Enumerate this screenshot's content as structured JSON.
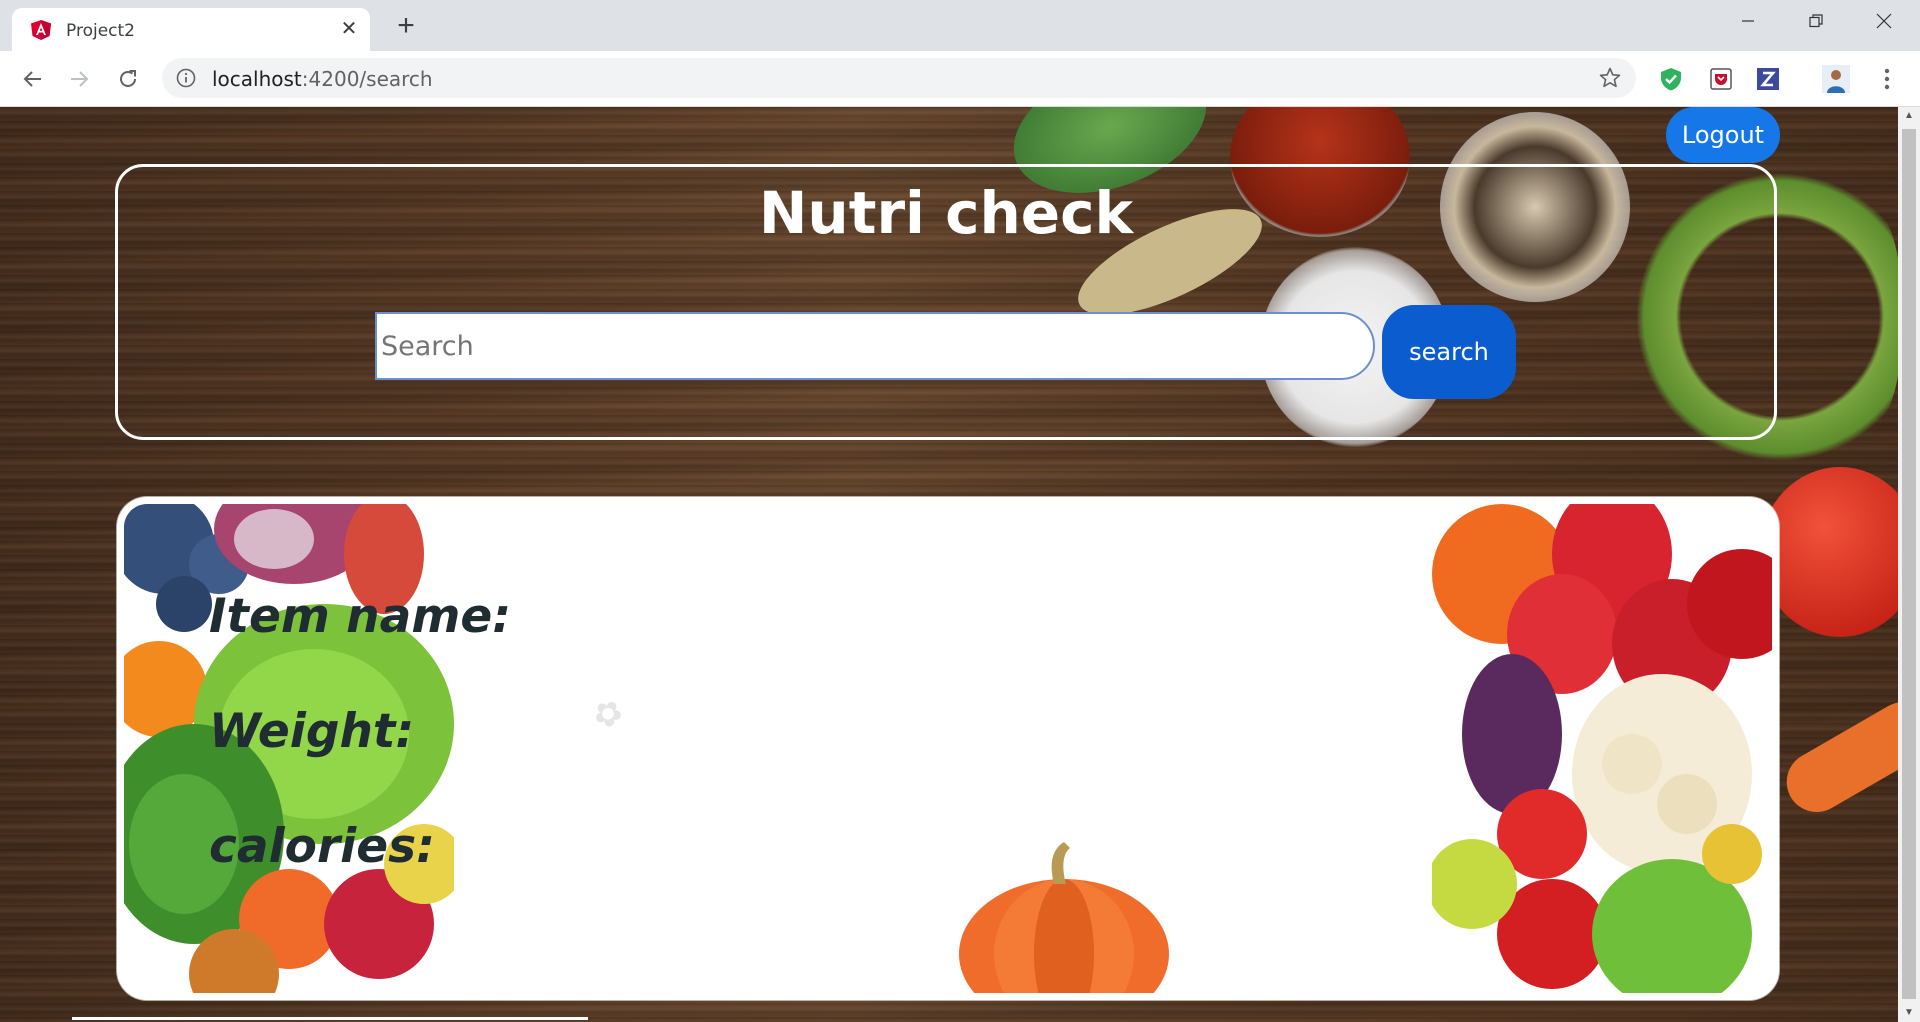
{
  "browser": {
    "tab_title": "Project2",
    "url_host": "localhost",
    "url_rest": ":4200/search"
  },
  "header": {
    "logout_label": "Logout",
    "title": "Nutri check"
  },
  "search": {
    "placeholder": "Search",
    "value": "",
    "button_label": "search"
  },
  "result": {
    "item_name_label": "Item name:",
    "weight_label": "Weight:",
    "calories_label": "calories:"
  },
  "colors": {
    "accent_button": "#0a5ccf",
    "logout_button": "#1677e8",
    "label_text": "#1f2d33"
  }
}
